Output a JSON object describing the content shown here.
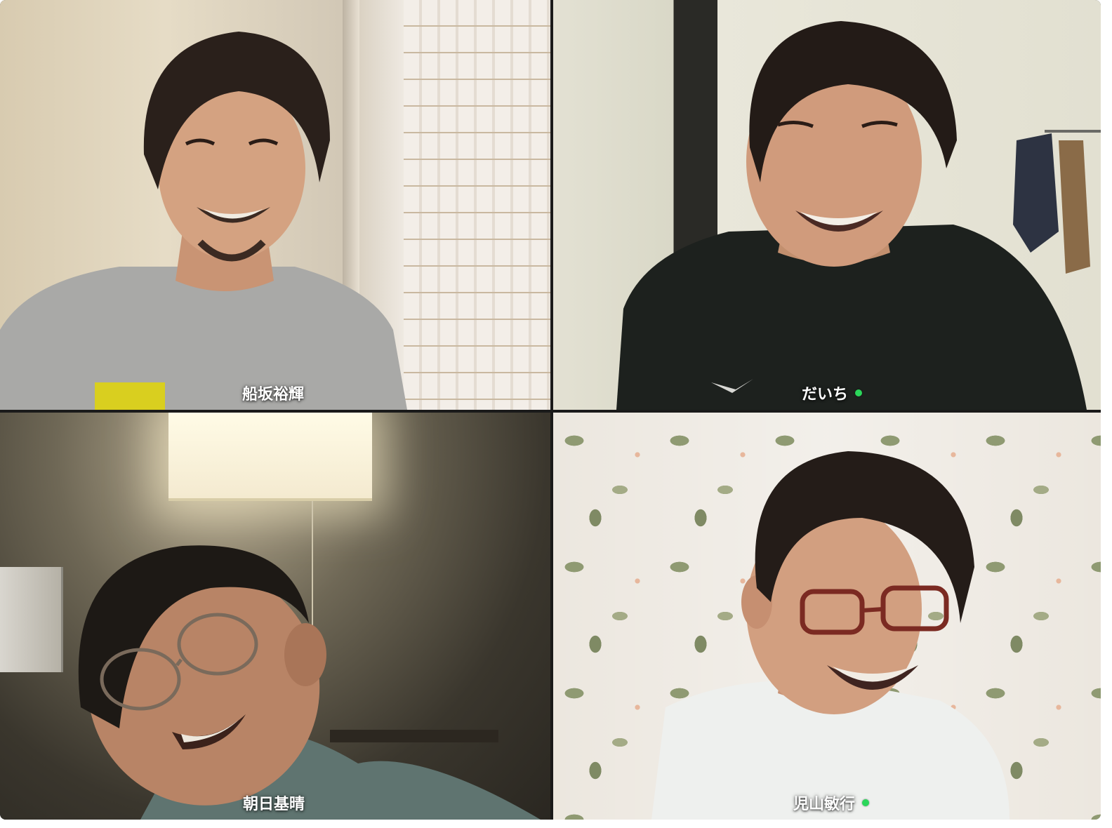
{
  "call": {
    "participants": [
      {
        "name": "船坂裕輝",
        "speaking": false
      },
      {
        "name": "だいち",
        "speaking": true
      },
      {
        "name": "朝日基晴",
        "speaking": false
      },
      {
        "name": "児山敏行",
        "speaking": true
      }
    ],
    "indicator_color": "#2bd65a"
  }
}
